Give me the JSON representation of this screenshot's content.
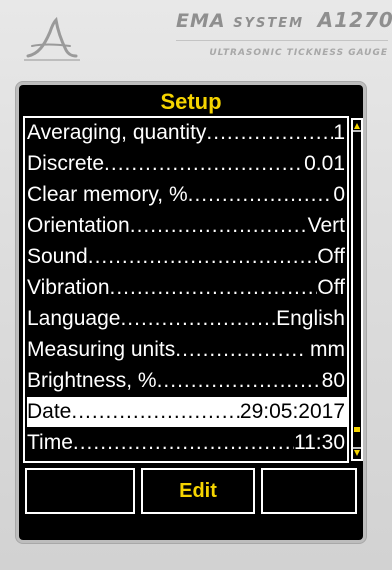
{
  "header": {
    "brand": "EMA",
    "system": "SYSTEM",
    "model": "A1270",
    "subtitle": "ULTRASONIC TICKNESS GAUGE"
  },
  "screen": {
    "title": "Setup",
    "items": [
      {
        "label": "Averaging, quantity",
        "value": "1"
      },
      {
        "label": "Discrete",
        "value": "0.01"
      },
      {
        "label": "Clear memory, %",
        "value": "0"
      },
      {
        "label": "Orientation",
        "value": "Vert"
      },
      {
        "label": "Sound",
        "value": "Off"
      },
      {
        "label": "Vibration",
        "value": "Off"
      },
      {
        "label": "Language",
        "value": "English"
      },
      {
        "label": "Measuring units",
        "value": " mm"
      },
      {
        "label": "Brightness, %",
        "value": "80"
      },
      {
        "label": "Date",
        "value": "29:05:2017",
        "selected": true
      },
      {
        "label": "Time",
        "value": "11:30"
      }
    ],
    "scroll_position": 0.95
  },
  "softkeys": {
    "left": "",
    "middle": "Edit",
    "right": ""
  },
  "colors": {
    "accent": "#f5d400",
    "screen_bg": "#000000",
    "text": "#ffffff",
    "selected_bg": "#ffffff"
  }
}
